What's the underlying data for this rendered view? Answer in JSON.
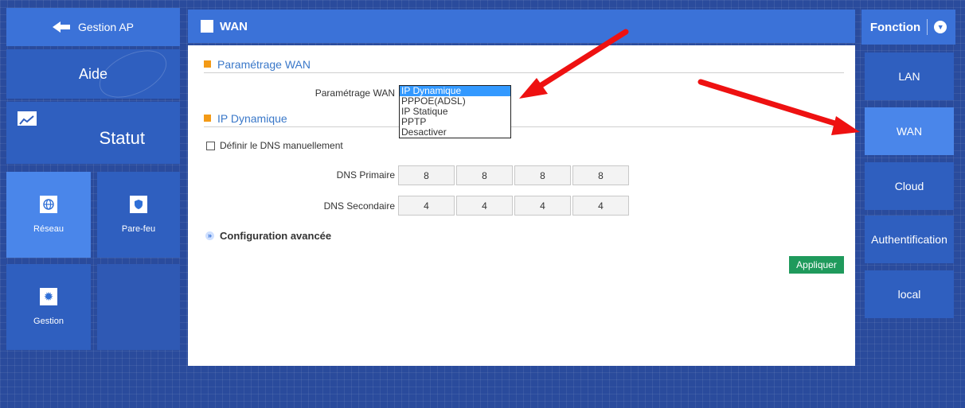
{
  "left_nav": {
    "back_label": "Gestion AP",
    "aide_label": "Aide",
    "statut_label": "Statut",
    "reseau_label": "Réseau",
    "parefeu_label": "Pare-feu",
    "gestion_label": "Gestion"
  },
  "main": {
    "title": "WAN",
    "section_wan": "Paramétrage WAN",
    "wan_label": "Paramétrage WAN",
    "dropdown_options": [
      "IP Dynamique",
      "PPPOE(ADSL)",
      "IP Statique",
      "PPTP",
      "Desactiver"
    ],
    "dropdown_selected": "IP Dynamique",
    "section_ip": "IP Dynamique",
    "dns_manual_label": "Définir le DNS manuellement",
    "dns_primary_label": "DNS Primaire",
    "dns_primary": [
      "8",
      "8",
      "8",
      "8"
    ],
    "dns_secondary_label": "DNS Secondaire",
    "dns_secondary": [
      "4",
      "4",
      "4",
      "4"
    ],
    "advanced_label": "Configuration avancée",
    "apply_label": "Appliquer"
  },
  "right_nav": {
    "header": "Fonction",
    "items": [
      "LAN",
      "WAN",
      "Cloud",
      "Authentification",
      "local"
    ],
    "active": "WAN"
  },
  "annotation_color": "#ee1111",
  "accent": "#3b72d8"
}
